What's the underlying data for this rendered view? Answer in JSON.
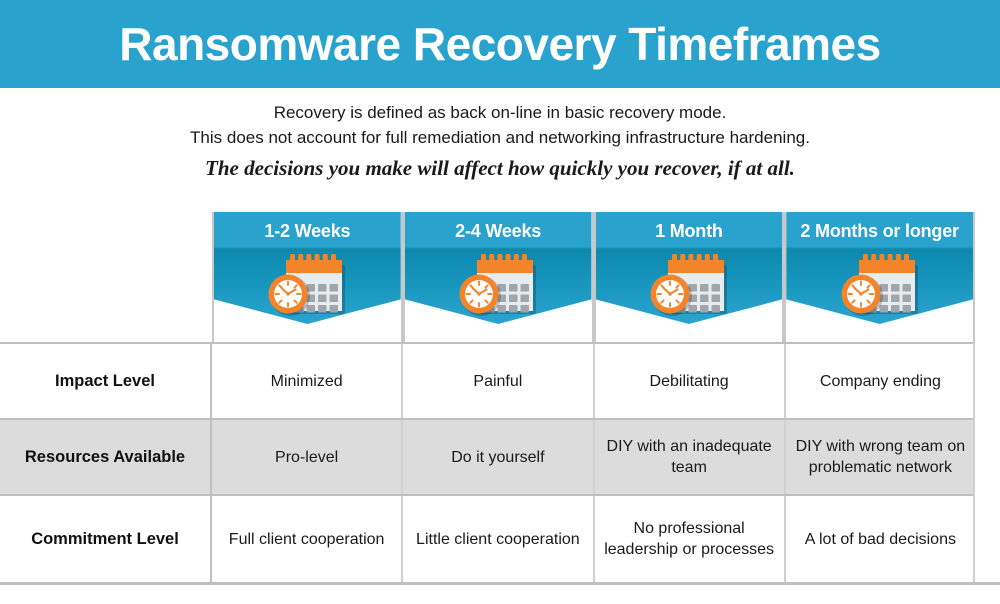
{
  "banner": {
    "title": "Ransomware Recovery Timeframes",
    "bg_color": "#29a3cd",
    "text_color": "#ffffff"
  },
  "subtitle": {
    "line1": "Recovery is defined as back on-line in basic recovery mode.",
    "line2": "This does not account for full remediation and networking infrastructure hardening.",
    "emphasis": "The decisions you make will affect how quickly you recover, if at all."
  },
  "matrix": {
    "icon_name": "calendar-clock-icon",
    "accent_color": "#29a3cd",
    "accent_dark_color": "#0d88ad",
    "icon_orange": "#f3842a",
    "zebra_color": "#dcdcdc",
    "columns": [
      {
        "header": "1-2 Weeks"
      },
      {
        "header": "2-4 Weeks"
      },
      {
        "header": "1 Month"
      },
      {
        "header": "2 Months or longer"
      }
    ],
    "rows": [
      {
        "label": "Impact Level",
        "shaded": false,
        "cells": [
          "Minimized",
          "Painful",
          "Debilitating",
          "Company ending"
        ]
      },
      {
        "label": "Resources Available",
        "shaded": true,
        "cells": [
          "Pro-level",
          "Do it yourself",
          "DIY with an inadequate team",
          "DIY with wrong team on problematic network"
        ]
      },
      {
        "label": "Commitment Level",
        "shaded": false,
        "cells": [
          "Full client cooperation",
          "Little client cooperation",
          "No professional leadership or processes",
          "A lot of bad decisions"
        ]
      }
    ]
  }
}
